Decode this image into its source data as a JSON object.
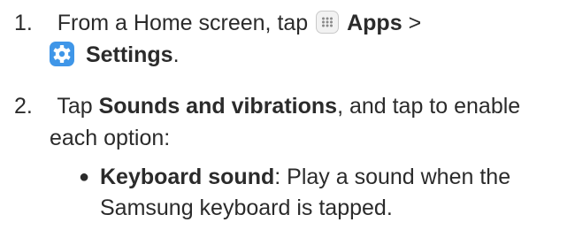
{
  "steps": [
    {
      "number": "1.",
      "line1": {
        "pre": "From a Home screen, tap",
        "apps_label": "Apps",
        "separator": ">"
      },
      "line2": {
        "settings_label": "Settings",
        "end": "."
      }
    },
    {
      "number": "2.",
      "line1": {
        "pre": "Tap",
        "bold": "Sounds and vibrations",
        "post": ", and tap to enable"
      },
      "line2": "each option:"
    }
  ],
  "bullets": [
    {
      "bold": "Keyboard sound",
      "line1_post": ": Play a sound when the",
      "line2": "Samsung keyboard is tapped."
    }
  ],
  "icons": {
    "apps": "apps-grid-icon",
    "settings": "gear-icon"
  },
  "colors": {
    "text": "#2b2b2b",
    "settings_icon_bg": "#3f96e8",
    "apps_icon_bg": "#f2f2f2"
  }
}
